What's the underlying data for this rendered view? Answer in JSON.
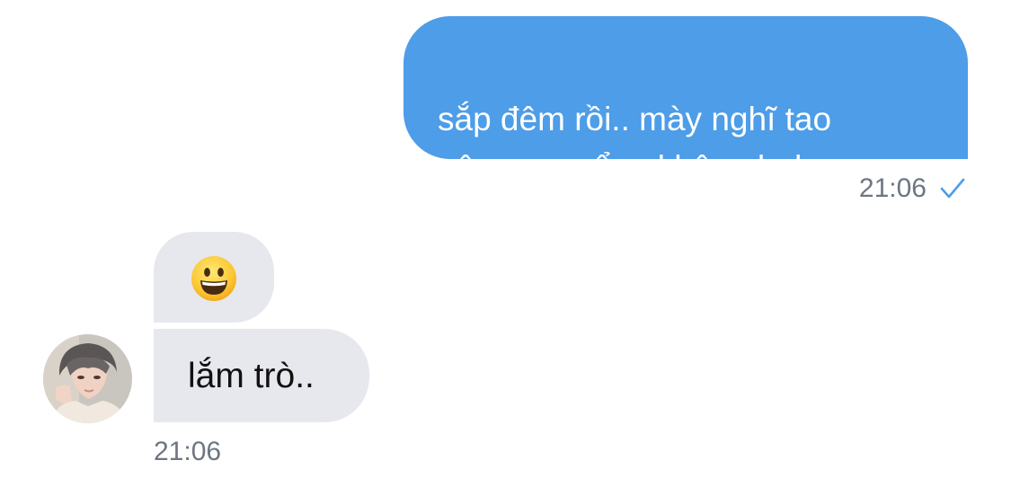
{
  "conversation": {
    "outgoing": {
      "text": "sắp đêm rồi.. mày nghĩ tao\nnên spam ổng không hehe",
      "time": "21:06",
      "status_icon": "check-icon",
      "bubble_color": "#4d9de8"
    },
    "incoming": {
      "emoji_icon": "grinning-face-icon",
      "text": "lắm trò..",
      "time": "21:06",
      "bubble_color": "#e6e8ee",
      "avatar_icon": "avatar"
    }
  }
}
